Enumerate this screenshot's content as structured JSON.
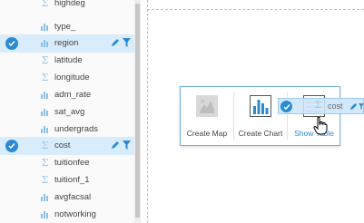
{
  "field_panel": {
    "fields": [
      {
        "name": "highdeg",
        "type": "number",
        "selected": false
      },
      {
        "name": "type_",
        "type": "string",
        "selected": false
      },
      {
        "name": "region",
        "type": "string",
        "selected": true
      },
      {
        "name": "latitude",
        "type": "number",
        "selected": false
      },
      {
        "name": "longitude",
        "type": "number",
        "selected": false
      },
      {
        "name": "adm_rate",
        "type": "string",
        "selected": false
      },
      {
        "name": "sat_avg",
        "type": "string",
        "selected": false
      },
      {
        "name": "undergrads",
        "type": "string",
        "selected": false
      },
      {
        "name": "cost",
        "type": "number",
        "selected": true
      },
      {
        "name": "tuitionfee",
        "type": "number",
        "selected": false
      },
      {
        "name": "tuitionf_1",
        "type": "number",
        "selected": false
      },
      {
        "name": "avgfacsal",
        "type": "string",
        "selected": false
      },
      {
        "name": "notworking",
        "type": "string",
        "selected": false
      }
    ],
    "icons": {
      "number": "sigma-icon",
      "string": "bar-chart-icon",
      "edit": "pencil-icon",
      "filter": "filter-icon",
      "selected": "check-circle-icon"
    }
  },
  "drop_options": {
    "create_map": "Create Map",
    "create_chart": "Create Chart",
    "show_table": "Show Table"
  },
  "drag_ghost": {
    "label": "cost"
  },
  "colors": {
    "accent": "#2a8bd0",
    "selected_row": "#d8ecfb",
    "icon_light": "#8dc0e8"
  }
}
